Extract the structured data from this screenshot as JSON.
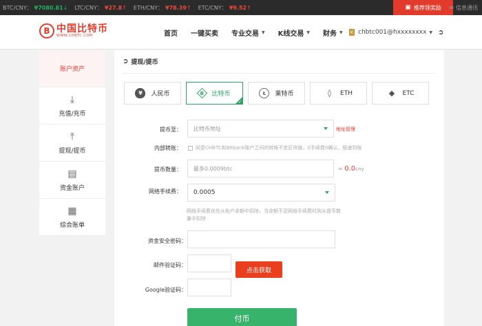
{
  "ticker": [
    {
      "pair": "BTC/CNY：",
      "price": "¥7080.81",
      "dir": "down"
    },
    {
      "pair": "LTC/CNY：",
      "price": "¥27.8",
      "dir": "up"
    },
    {
      "pair": "ETH/CNY：",
      "price": "¥78.39",
      "dir": "up"
    },
    {
      "pair": "ETC/CNY：",
      "price": "¥9.52",
      "dir": "up"
    }
  ],
  "promo": {
    "label": "推荐领奖励",
    "icon": "gift-icon"
  },
  "messages": {
    "label": "信息通讯",
    "icon": "envelope-icon"
  },
  "brand": {
    "cn": "中国比特币",
    "en": "WWW.CHBTC.COM",
    "mark": "B",
    "color": "#e23b2b"
  },
  "nav": [
    {
      "label": "首页",
      "dropdown": false
    },
    {
      "label": "一键买卖",
      "dropdown": false
    },
    {
      "label": "专业交易",
      "dropdown": true
    },
    {
      "label": "K线交易",
      "dropdown": true
    },
    {
      "label": "财务",
      "dropdown": true
    }
  ],
  "user": {
    "badge": "K",
    "name": "chbtc001@hxxxxxxxx",
    "logout_icon": "logout-icon"
  },
  "sidebar": [
    {
      "label": "账户资产",
      "icon": "",
      "active": true
    },
    {
      "label": "充值/充币",
      "icon": "download-icon",
      "active": false
    },
    {
      "label": "提现/提币",
      "icon": "upload-icon",
      "active": false
    },
    {
      "label": "资金账户",
      "icon": "card-icon",
      "active": false
    },
    {
      "label": "综合账单",
      "icon": "grid-icon",
      "active": false
    }
  ],
  "page": {
    "title": "提现/提币",
    "title_icon": "exit-icon"
  },
  "coins": [
    {
      "label": "人民币",
      "icon": "money-bag-icon",
      "active": false
    },
    {
      "label": "比特币",
      "icon": "bitcoin-icon",
      "active": true
    },
    {
      "label": "莱特币",
      "icon": "litecoin-icon",
      "active": false
    },
    {
      "label": "ETH",
      "icon": "ethereum-icon",
      "active": false
    },
    {
      "label": "ETC",
      "icon": "ethereum-classic-icon",
      "active": false
    }
  ],
  "form": {
    "address_label": "提币至：",
    "address_placeholder": "比特币地址",
    "address_link": "地址管理",
    "internal_label": "内部转账：",
    "internal_text": "同意CHBTC和Bitbank账户之间的转账不走区块链，0手续费0确认，极速到账",
    "amount_label": "提币数量：",
    "amount_placeholder": "最多0.0009btc",
    "approx_prefix": "≈ ",
    "approx_value": "0.0",
    "approx_unit": "cny",
    "fee_label": "网络手续费：",
    "fee_value": "0.0005",
    "fee_note": "网络手续费优先从账户余额中扣除，当余额不足网络手续费时则从提币数量中扣除",
    "password_label": "资金安全密码：",
    "email_label": "邮件验证码：",
    "send_code": "点击获取",
    "google_label": "Google验证码：",
    "submit": "付币"
  },
  "colors": {
    "accent": "#2ea46a",
    "brand": "#e23b2b",
    "submit": "#37b36b",
    "send": "#e8401f"
  }
}
